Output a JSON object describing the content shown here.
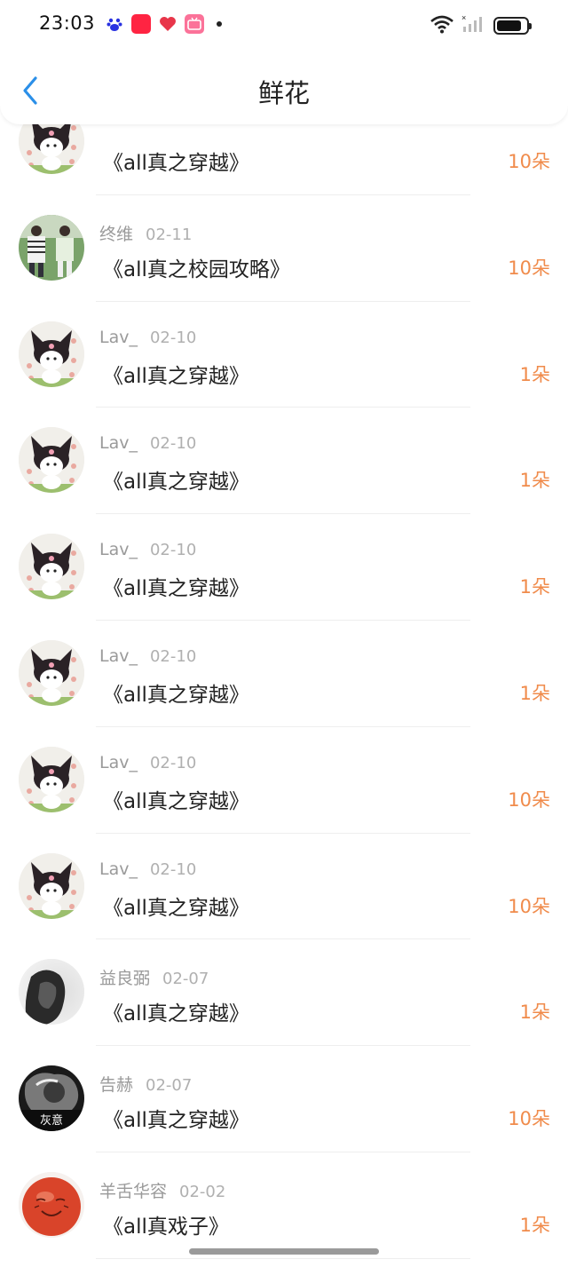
{
  "status": {
    "time": "23:03",
    "apps": [
      "baidu-icon",
      "xiaohongshu-icon",
      "heart-app-icon",
      "bilibili-icon"
    ],
    "battery_level": 0.85
  },
  "nav": {
    "title": "鲜花"
  },
  "colors": {
    "accent": "#f08b4b",
    "back": "#2b8fe8",
    "meta": "#9a9a9a"
  },
  "rows": [
    {
      "user": "",
      "date": "",
      "work": "《all真之穿越》",
      "count": "10朵",
      "avatar": "kuromi"
    },
    {
      "user": "终维",
      "date": "02-11",
      "work": "《all真之校园攻略》",
      "count": "10朵",
      "avatar": "photo"
    },
    {
      "user": "Lav_",
      "date": "02-10",
      "work": "《all真之穿越》",
      "count": "1朵",
      "avatar": "kuromi"
    },
    {
      "user": "Lav_",
      "date": "02-10",
      "work": "《all真之穿越》",
      "count": "1朵",
      "avatar": "kuromi"
    },
    {
      "user": "Lav_",
      "date": "02-10",
      "work": "《all真之穿越》",
      "count": "1朵",
      "avatar": "kuromi"
    },
    {
      "user": "Lav_",
      "date": "02-10",
      "work": "《all真之穿越》",
      "count": "1朵",
      "avatar": "kuromi"
    },
    {
      "user": "Lav_",
      "date": "02-10",
      "work": "《all真之穿越》",
      "count": "10朵",
      "avatar": "kuromi"
    },
    {
      "user": "Lav_",
      "date": "02-10",
      "work": "《all真之穿越》",
      "count": "10朵",
      "avatar": "kuromi"
    },
    {
      "user": "益良弼",
      "date": "02-07",
      "work": "《all真之穿越》",
      "count": "1朵",
      "avatar": "gray"
    },
    {
      "user": "告赫",
      "date": "02-07",
      "work": "《all真之穿越》",
      "count": "10朵",
      "avatar": "dark",
      "avatar_text": "灰意"
    },
    {
      "user": "羊舌华容",
      "date": "02-02",
      "work": "《all真戏子》",
      "count": "1朵",
      "avatar": "red"
    }
  ]
}
